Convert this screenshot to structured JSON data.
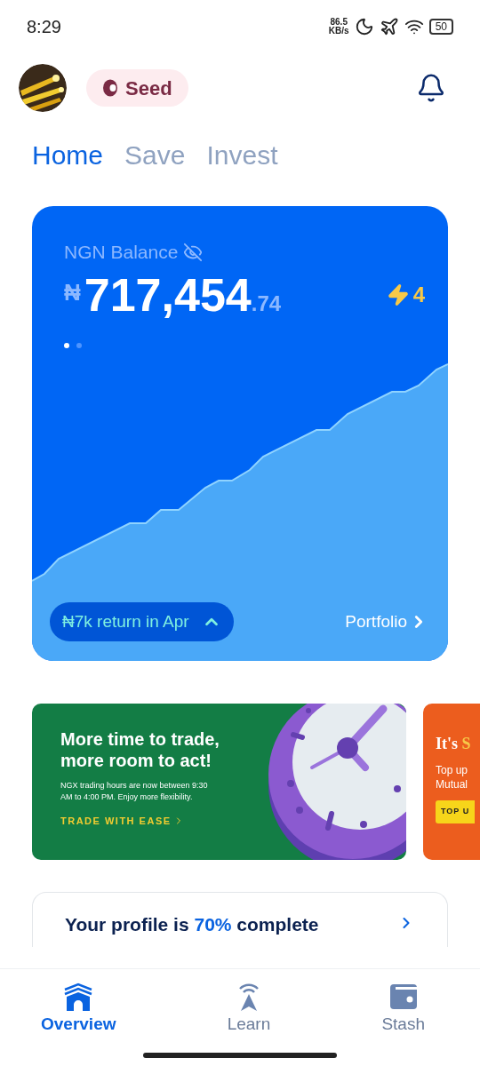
{
  "status_bar": {
    "time": "8:29",
    "speed_value": "86.5",
    "speed_unit": "KB/s",
    "battery": "50"
  },
  "header": {
    "badge": "Seed"
  },
  "tabs": [
    {
      "label": "Home",
      "selected": true
    },
    {
      "label": "Save",
      "selected": false
    },
    {
      "label": "Invest",
      "selected": false
    }
  ],
  "balance_card": {
    "label": "NGN Balance",
    "currency": "₦",
    "amount": "717,454",
    "decimals": ".74",
    "streak": "4",
    "pages": [
      {
        "selected": true
      },
      {
        "selected": false
      }
    ],
    "return_pill": "₦7k return in Apr",
    "portfolio_link": "Portfolio"
  },
  "promos": [
    {
      "kind": "trade",
      "title": "More time to trade, more room to act!",
      "body": "NGX trading hours are now between 9:30 AM to 4:00 PM. Enjoy more flexibility.",
      "cta": "TRADE WITH EASE"
    },
    {
      "kind": "topup",
      "title_start": "It's ",
      "title_accent": "S",
      "line1": "Top up",
      "line2": "Mutual",
      "cta": "TOP U"
    }
  ],
  "profile_card": {
    "title": "Your profile is **70%** complete"
  },
  "bottom_nav": [
    {
      "label": "Overview",
      "kind": "home",
      "selected": true
    },
    {
      "label": "Learn",
      "kind": "learn",
      "selected": false
    },
    {
      "label": "Stash",
      "kind": "wallet",
      "selected": false
    }
  ]
}
